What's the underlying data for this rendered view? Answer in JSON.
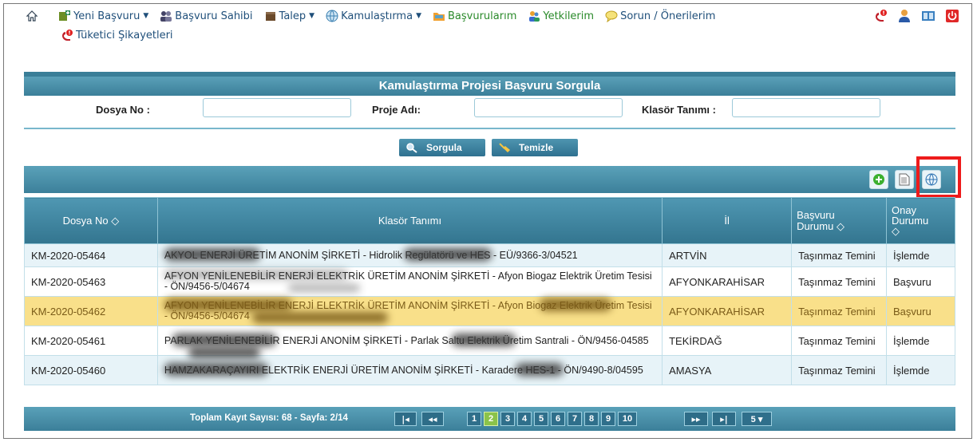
{
  "nav": {
    "items": [
      {
        "label": "Yeni Başvuru",
        "caret": true
      },
      {
        "label": "Başvuru Sahibi",
        "caret": false
      },
      {
        "label": "Talep",
        "caret": true
      },
      {
        "label": "Kamulaştırma",
        "caret": true
      },
      {
        "label": "Başvurularım",
        "caret": false
      },
      {
        "label": "Yetkilerim",
        "caret": false
      },
      {
        "label": "Sorun / Önerilerim",
        "caret": false
      }
    ],
    "second": "Tüketici Şikayetleri"
  },
  "title": "Kamulaştırma Projesi Başvuru Sorgula",
  "search": {
    "dosya_label": "Dosya No :",
    "proje_label": "Proje Adı:",
    "klasor_label": "Klasör Tanımı :",
    "dosya_value": "",
    "proje_value": "",
    "klasor_value": ""
  },
  "buttons": {
    "sorgula": "Sorgula",
    "temizle": "Temizle"
  },
  "table": {
    "headers": {
      "dosya": "Dosya No",
      "klasor": "Klasör Tanımı",
      "il": "İl",
      "basvuru1": "Başvuru",
      "basvuru2": "Durumu",
      "onay1": "Onay",
      "onay2": "Durumu",
      "sort_glyph": "◇"
    },
    "rows": [
      {
        "dosya": "KM-2020-05464",
        "klasor": "AKYOL ENERJİ ÜRETİM ANONİM ŞİRKETİ - Hidrolik Regülatörü ve HES - EÜ/9366-3/04521",
        "il": "ARTVİN",
        "basvuru": "Taşınmaz Temini",
        "onay": "İşlemde"
      },
      {
        "dosya": "KM-2020-05463",
        "klasor": "AFYON YENİLENEBİLİR ENERJİ ELEKTRİK ÜRETİM ANONİM ŞİRKETİ - Afyon Biogaz Elektrik Üretim Tesisi - ÖN/9456-5/04674",
        "il": "AFYONKARAHİSAR",
        "basvuru": "Taşınmaz Temini",
        "onay": "Başvuru"
      },
      {
        "dosya": "KM-2020-05462",
        "klasor": "AFYON YENİLENEBİLİR ENERJİ ELEKTRİK ÜRETİM ANONİM ŞİRKETİ - Afyon Biogaz Elektrik Üretim Tesisi - ÖN/9456-5/04674",
        "il": "AFYONKARAHİSAR",
        "basvuru": "Taşınmaz Temini",
        "onay": "Başvuru"
      },
      {
        "dosya": "KM-2020-05461",
        "klasor": "PARLAK YENİLENEBİLİR ENERJİ ANONİM ŞİRKETİ - Parlak Saltu Elektrik Üretim Santrali - ÖN/9456-04585",
        "il": "TEKİRDAĞ",
        "basvuru": "Taşınmaz Temini",
        "onay": "İşlemde"
      },
      {
        "dosya": "KM-2020-05460",
        "klasor": "HAMZAKARAÇAYIRI ELEKTRİK ENERJİ ÜRETİM ANONİM ŞİRKETİ - Karadere HES-1 - ÖN/9490-8/04595",
        "il": "AMASYA",
        "basvuru": "Taşınmaz Temini",
        "onay": "İşlemde"
      }
    ]
  },
  "pager": {
    "summary": "Toplam Kayıt Sayısı: 68 - Sayfa: 2/14",
    "first": "|◂",
    "prev": "◂◂",
    "next": "▸▸",
    "last": "▸|",
    "pages": [
      "1",
      "2",
      "3",
      "4",
      "5",
      "6",
      "7",
      "8",
      "9",
      "10"
    ],
    "active_page": "2",
    "page_size": "5 ▾"
  }
}
